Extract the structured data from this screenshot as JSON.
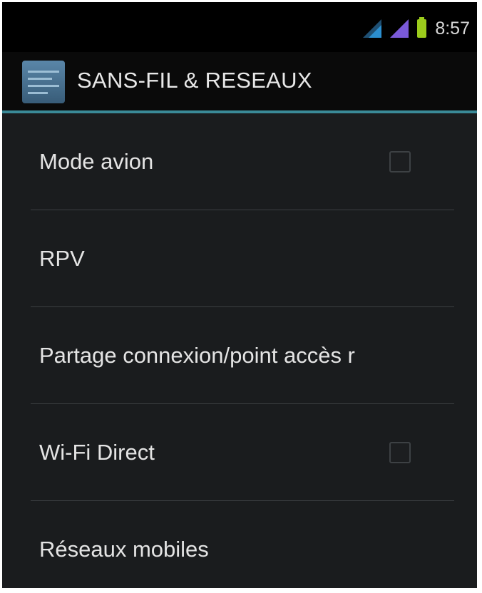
{
  "status_bar": {
    "clock": "8:57",
    "icons": [
      "signal-wifi-icon",
      "signal-cellular-icon",
      "battery-icon"
    ],
    "colors": {
      "wifi_signal": "#2b8fd0",
      "cell_signal": "#7a5ad8",
      "battery": "#9ccc1c"
    }
  },
  "action_bar": {
    "icon": "wireless-settings-icon",
    "title": "SANS-FIL & RESEAUX",
    "accent_color": "#3a8a98"
  },
  "settings": [
    {
      "label": "Mode avion",
      "has_checkbox": true,
      "checked": false
    },
    {
      "label": "RPV",
      "has_checkbox": false
    },
    {
      "label": "Partage connexion/point accès r",
      "has_checkbox": false
    },
    {
      "label": "Wi-Fi Direct",
      "has_checkbox": true,
      "checked": false
    },
    {
      "label": "Réseaux mobiles",
      "has_checkbox": false
    }
  ]
}
